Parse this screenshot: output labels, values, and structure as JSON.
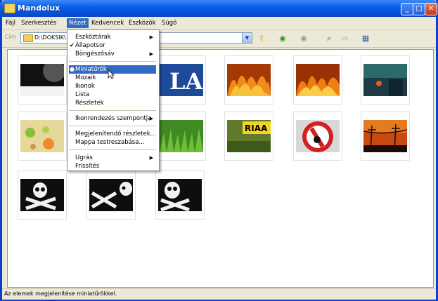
{
  "window": {
    "title": "Mandolux"
  },
  "menubar": {
    "items": [
      "Fájl",
      "Szerkesztés",
      "Nézet",
      "Kedvencek",
      "Eszközök",
      "Súgó"
    ]
  },
  "address": {
    "label": "Cím",
    "value": "D:\\DOKSIK\\"
  },
  "view_menu": {
    "items": [
      {
        "label": "Eszköztárak",
        "submenu": true
      },
      {
        "label": "Állapotsor",
        "checked": true
      },
      {
        "label": "Böngészősáv",
        "submenu": true
      },
      {
        "label": "Miniatűrök",
        "selected": true
      },
      {
        "label": "Mozaik"
      },
      {
        "label": "Ikonok"
      },
      {
        "label": "Lista"
      },
      {
        "label": "Részletek"
      },
      {
        "label": "Ikonrendezés szempontja",
        "submenu": true
      },
      {
        "label": "Megjelenítendő részletek..."
      },
      {
        "label": "Mappa testreszabása..."
      },
      {
        "label": "Ugrás",
        "submenu": true
      },
      {
        "label": "Frissítés"
      }
    ]
  },
  "thumbnails": {
    "row1": [
      "baseball-closeup",
      "la-dodgers-logo",
      "flames-1",
      "flames-2",
      "dark-blue-scene"
    ],
    "row2": [
      "tennis-balls",
      "green-grass",
      "riaa-sign",
      "traffic-sign",
      "sunset-power-lines"
    ],
    "row3": [
      "pirate-flag-1",
      "pirate-flag-2",
      "pirate-flag-3"
    ],
    "riaa_text": "RIAA"
  },
  "status": {
    "text": "Az elemek megjelenítése miniatűrökkel."
  },
  "colors": {
    "titlebar": "#0351d6",
    "highlight": "#316ac5"
  }
}
